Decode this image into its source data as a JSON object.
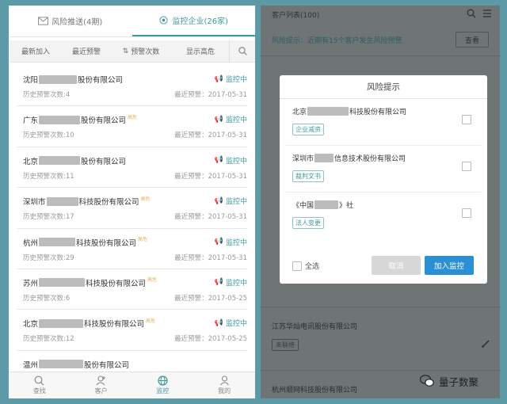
{
  "left": {
    "tabs": [
      {
        "label": "风险推送(4期)",
        "icon": "mail-icon"
      },
      {
        "label": "监控企业(26家)",
        "icon": "radar-icon",
        "active": true
      }
    ],
    "sort": [
      {
        "label": "最新加入"
      },
      {
        "label": "最近预警"
      },
      {
        "label": "预警次数"
      },
      {
        "label": "显示高危"
      }
    ],
    "items": [
      {
        "pre": "沈阳",
        "post": "股份有限公司",
        "tag": "",
        "hist": "历史预警次数:4",
        "status": "监控中",
        "date": "最近预警：2017-05-31"
      },
      {
        "pre": "广东",
        "post": "股份有限公司",
        "tag": "高危",
        "hist": "历史预警次数:10",
        "status": "监控中",
        "date": "最近预警：2017-05-31"
      },
      {
        "pre": "北京",
        "post": "股份有限公司",
        "tag": "",
        "hist": "历史预警次数:11",
        "status": "监控中",
        "date": "最近预警：2017-05-31"
      },
      {
        "pre": "深圳市",
        "post": "科技股份有限公司",
        "tag": "高危",
        "hist": "历史预警次数:17",
        "status": "监控中",
        "date": "最近预警：2017-05-31"
      },
      {
        "pre": "杭州",
        "post": "科技股份有限公司",
        "tag": "高危",
        "hist": "历史预警次数:29",
        "status": "监控中",
        "date": "最近预警：2017-05-31"
      },
      {
        "pre": "苏州",
        "post": "科技股份有限公司",
        "tag": "高危",
        "hist": "历史预警次数:6",
        "status": "监控中",
        "date": "最近预警：2017-05-25"
      },
      {
        "pre": "北京",
        "post": "科技股份有限公司",
        "tag": "高危",
        "hist": "历史预警次数:12",
        "status": "监控中",
        "date": "最近预警：2017-05-25"
      },
      {
        "pre": "温州",
        "post": "股份有限公司",
        "tag": "",
        "hist": "",
        "status": "",
        "date": ""
      }
    ],
    "nav": [
      {
        "label": "查找",
        "icon": "search-icon"
      },
      {
        "label": "客户",
        "icon": "user-add-icon"
      },
      {
        "label": "监控",
        "icon": "globe-icon",
        "active": true
      },
      {
        "label": "我的",
        "icon": "profile-icon"
      }
    ]
  },
  "right": {
    "header_title": "客户列表(100)",
    "warn_text": "风险提示：近期有15个客户发生风险预警",
    "view_btn": "查看",
    "bg_rows": [
      {
        "name": "",
        "tag": "",
        "top": 0
      },
      {
        "name": "江苏华灿电讯股份有限公司",
        "tag": "未联络"
      },
      {
        "name": "杭州顺网科技股份有限公司",
        "tag": ""
      }
    ],
    "dialog": {
      "title": "风险提示",
      "items": [
        {
          "pre": "北京",
          "post": "科技股份有限公司",
          "tag": "企业减资"
        },
        {
          "pre": "深圳市",
          "post": "信息技术股份有限公司",
          "tag": "裁判文书"
        },
        {
          "pre": "《中国",
          "post": "》社",
          "tag": "法人变更"
        }
      ],
      "select_all": "全选",
      "cancel": "取消",
      "add": "加入监控"
    }
  },
  "watermark": "量子数聚"
}
